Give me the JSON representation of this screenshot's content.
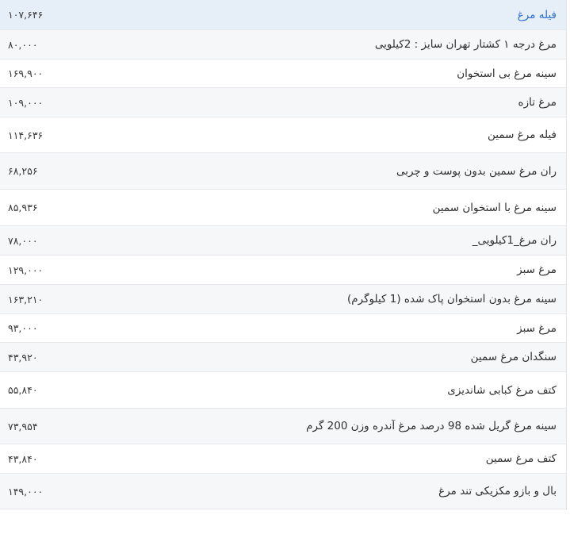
{
  "table": {
    "header": {
      "name": "فیله مرغ",
      "price": "۱۰۷,۶۴۶"
    },
    "rows": [
      {
        "name": "مرغ درجه ۱ کشتار تهران سایز : 2کیلویی",
        "price": "۸۰,۰۰۰"
      },
      {
        "name": "سینه مرغ بی استخوان",
        "price": "۱۶۹,۹۰۰"
      },
      {
        "name": "مرغ تازه",
        "price": "۱۰۹,۰۰۰"
      },
      {
        "name": "فیله مرغ سمین",
        "price": "۱۱۴,۶۳۶"
      },
      {
        "name": "ران مرغ سمین بدون پوست و چربی",
        "price": "۶۸,۲۵۶"
      },
      {
        "name": "سینه مرغ با استخوان سمین",
        "price": "۸۵,۹۳۶"
      },
      {
        "name": "ران مرغ_1کیلویی_",
        "price": "۷۸,۰۰۰"
      },
      {
        "name": "مرغ سبز",
        "price": "۱۲۹,۰۰۰"
      },
      {
        "name": "سینه مرغ بدون استخوان پاک شده (1 کیلوگرم)",
        "price": "۱۶۳,۲۱۰"
      },
      {
        "name": "مرغ سبز",
        "price": "۹۳,۰۰۰"
      },
      {
        "name": "سنگدان مرغ سمین",
        "price": "۴۳,۹۲۰"
      },
      {
        "name": "کتف مرغ کبابی شاندیزی",
        "price": "۵۵,۸۴۰"
      },
      {
        "name": "سینه مرغ گریل شده 98 درصد مرغ آندره وزن 200 گرم",
        "price": "۷۳,۹۵۴"
      },
      {
        "name": "کتف مرغ سمین",
        "price": "۴۳,۸۴۰"
      },
      {
        "name": "بال و بازو مکزیکی تند مرغ",
        "price": "۱۴۹,۰۰۰"
      }
    ]
  }
}
